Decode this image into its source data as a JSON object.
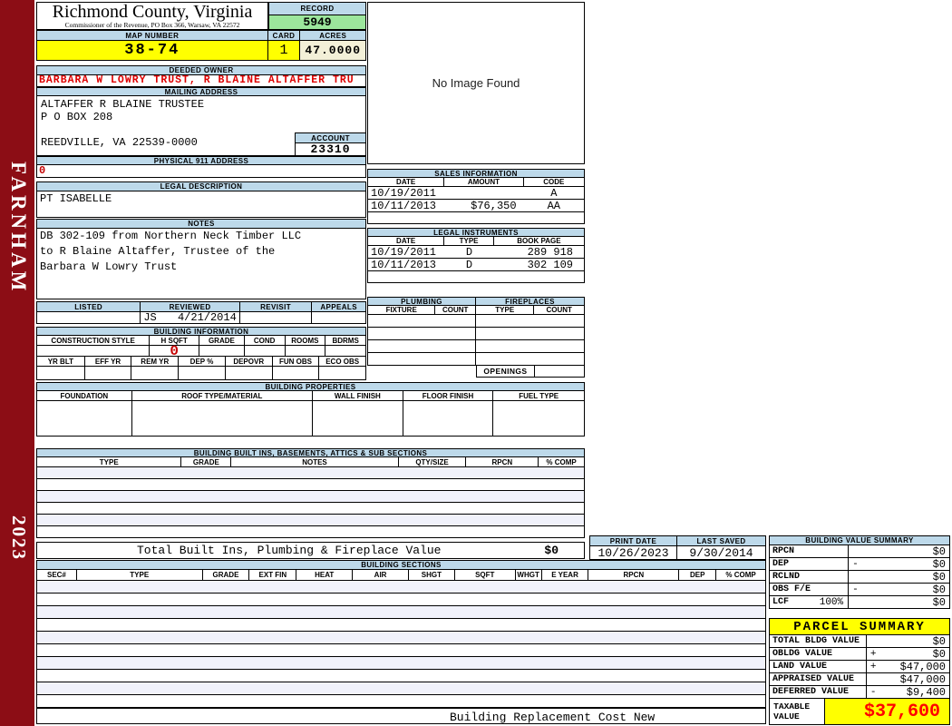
{
  "sidebar": {
    "district": "FARNHAM",
    "year": "2023"
  },
  "header": {
    "county_title": "Richmond County, Virginia",
    "commissioner_line": "Commissioner of the Revenue, PO Box 366, Warsaw, VA 22572",
    "record_label": "RECORD",
    "record_number": "5949",
    "map_number_label": "MAP NUMBER",
    "map_number": "38-74",
    "card_label": "CARD",
    "card": "1",
    "acres_label": "ACRES",
    "acres": "47.0000"
  },
  "owner": {
    "label": "DEEDED OWNER",
    "name": "BARBARA W LOWRY TRUST, R BLAINE ALTAFFER TRU"
  },
  "mailing": {
    "label": "MAILING ADDRESS",
    "line1": "ALTAFFER R BLAINE TRUSTEE",
    "line2": "P O BOX 208",
    "line3": "REEDVILLE, VA 22539-0000",
    "account_label": "ACCOUNT",
    "account_number": "23310"
  },
  "physical_911": {
    "label": "PHYSICAL 911 ADDRESS",
    "value": "0"
  },
  "legal_description": {
    "label": "LEGAL DESCRIPTION",
    "value": "PT ISABELLE"
  },
  "notes": {
    "label": "NOTES",
    "line1": "DB 302-109 from Northern Neck Timber LLC",
    "line2": "to R Blaine Altaffer, Trustee of the",
    "line3": "Barbara W Lowry Trust"
  },
  "review": {
    "listed_label": "LISTED",
    "reviewed_label": "REVIEWED",
    "revisit_label": "REVISIT",
    "appeals_label": "APPEALS",
    "reviewed_by": "JS",
    "reviewed_date": "4/21/2014"
  },
  "building_information": {
    "title": "BUILDING INFORMATION",
    "row1_columns": [
      "CONSTRUCTION STYLE",
      "H SQFT",
      "GRADE",
      "COND",
      "ROOMS",
      "BDRMS"
    ],
    "h_sqft_value": "0",
    "row2_columns": [
      "YR BLT",
      "EFF YR",
      "REM YR",
      "DEP %",
      "DEPOVR",
      "FUN OBS",
      "ECO OBS"
    ]
  },
  "image_panel": {
    "message": "No Image Found"
  },
  "sales_information": {
    "title": "SALES INFORMATION",
    "columns": [
      "DATE",
      "AMOUNT",
      "CODE"
    ],
    "rows": [
      {
        "date": "10/19/2011",
        "amount": "",
        "code": "A"
      },
      {
        "date": "10/11/2013",
        "amount": "$76,350",
        "code": "AA"
      }
    ]
  },
  "legal_instruments": {
    "title": "LEGAL INSTRUMENTS",
    "columns": [
      "DATE",
      "TYPE",
      "BOOK PAGE"
    ],
    "rows": [
      {
        "date": "10/19/2011",
        "type": "D",
        "book_page": "289 918"
      },
      {
        "date": "10/11/2013",
        "type": "D",
        "book_page": "302 109"
      }
    ]
  },
  "plumbing": {
    "title": "PLUMBING",
    "columns": [
      "FIXTURE",
      "COUNT"
    ]
  },
  "fireplaces": {
    "title": "FIREPLACES",
    "columns": [
      "TYPE",
      "COUNT"
    ],
    "openings_label": "OPENINGS"
  },
  "building_properties": {
    "title": "BUILDING PROPERTIES",
    "columns": [
      "FOUNDATION",
      "ROOF TYPE/MATERIAL",
      "WALL FINISH",
      "FLOOR FINISH",
      "FUEL TYPE"
    ]
  },
  "built_ins": {
    "title": "BUILDING BUILT INS, BASEMENTS, ATTICS & SUB SECTIONS",
    "columns": [
      "TYPE",
      "GRADE",
      "NOTES",
      "QTY/SIZE",
      "RPCN",
      "% COMP"
    ],
    "total_label": "Total Built Ins, Plumbing & Fireplace Value",
    "total_value": "$0"
  },
  "print_info": {
    "print_date_label": "PRINT DATE",
    "print_date": "10/26/2023",
    "last_saved_label": "LAST SAVED",
    "last_saved": "9/30/2014"
  },
  "building_sections": {
    "title": "BUILDING SECTIONS",
    "columns": [
      "SEC#",
      "TYPE",
      "GRADE",
      "EXT FIN",
      "HEAT",
      "AIR",
      "SHGT",
      "SQFT",
      "WHGT",
      "E YEAR",
      "RPCN",
      "DEP",
      "% COMP"
    ],
    "footer_note": "Building Replacement Cost New"
  },
  "building_value_summary": {
    "title": "BUILDING VALUE SUMMARY",
    "rows": [
      {
        "label": "RPCN",
        "pct": "",
        "op": "",
        "value": "$0"
      },
      {
        "label": "DEP",
        "pct": "",
        "op": "-",
        "value": "$0"
      },
      {
        "label": "RCLND",
        "pct": "",
        "op": "",
        "value": "$0"
      },
      {
        "label": "OBS F/E",
        "pct": "",
        "op": "-",
        "value": "$0"
      },
      {
        "label": "LCF",
        "pct": "100%",
        "op": "",
        "value": "$0"
      }
    ]
  },
  "parcel_summary": {
    "title": "PARCEL SUMMARY",
    "rows": [
      {
        "label": "TOTAL BLDG VALUE",
        "op": "",
        "value": "$0"
      },
      {
        "label": "OBLDG VALUE",
        "op": "+",
        "value": "$0"
      },
      {
        "label": "LAND VALUE",
        "op": "+",
        "value": "$47,000"
      },
      {
        "label": "APPRAISED VALUE",
        "op": "",
        "value": "$47,000"
      },
      {
        "label": "DEFERRED VALUE",
        "op": "-",
        "value": "$9,400"
      }
    ],
    "taxable_label": "TAXABLE VALUE",
    "taxable_value": "$37,600"
  },
  "colors": {
    "sidebar_red": "#8C0D15",
    "section_header_blue": "#BDD9EA",
    "highlight_yellow": "#FFFF00",
    "record_green": "#9CE69C",
    "acres_cream": "#F3F0D8",
    "owner_red": "#DD0000",
    "taxable_red": "#FF0000"
  }
}
